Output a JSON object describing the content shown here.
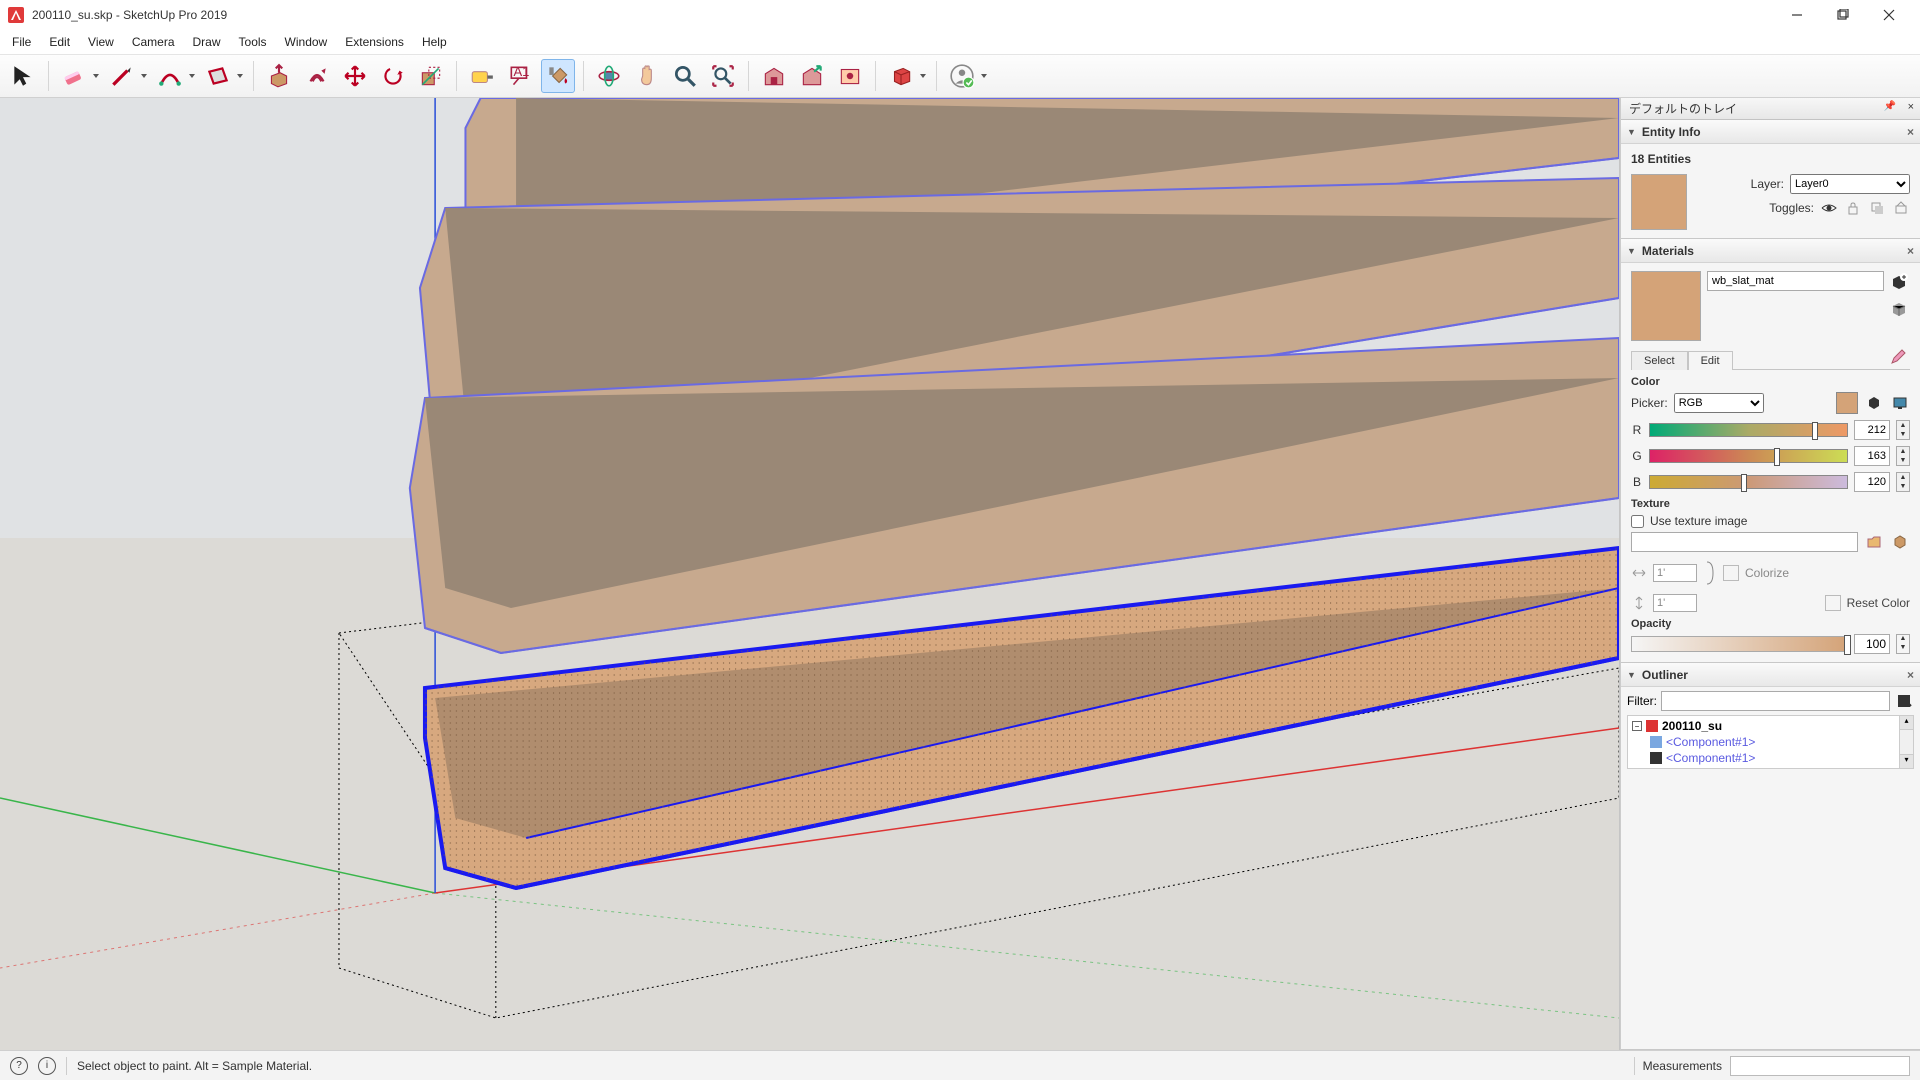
{
  "title": "200110_su.skp - SketchUp Pro 2019",
  "menus": [
    "File",
    "Edit",
    "View",
    "Camera",
    "Draw",
    "Tools",
    "Window",
    "Extensions",
    "Help"
  ],
  "status": {
    "hint": "Select object to paint. Alt = Sample Material.",
    "measurements_label": "Measurements"
  },
  "tray": {
    "title": "デフォルトのトレイ"
  },
  "entityInfo": {
    "header": "Entity Info",
    "count": "18 Entities",
    "layer_label": "Layer:",
    "layer_value": "Layer0",
    "toggles_label": "Toggles:"
  },
  "materials": {
    "header": "Materials",
    "name": "wb_slat_mat",
    "tab_select": "Select",
    "tab_edit": "Edit",
    "section_color": "Color",
    "picker_label": "Picker:",
    "picker_value": "RGB",
    "r": "212",
    "g": "163",
    "b": "120",
    "r_label": "R",
    "g_label": "G",
    "b_label": "B",
    "section_texture": "Texture",
    "use_texture": "Use texture image",
    "dim_w": "1'",
    "dim_h": "1'",
    "colorize": "Colorize",
    "reset": "Reset Color",
    "section_opacity": "Opacity",
    "opacity": "100"
  },
  "outliner": {
    "header": "Outliner",
    "filter_label": "Filter:",
    "root": "200110_su",
    "comp": "<Component#1>"
  }
}
